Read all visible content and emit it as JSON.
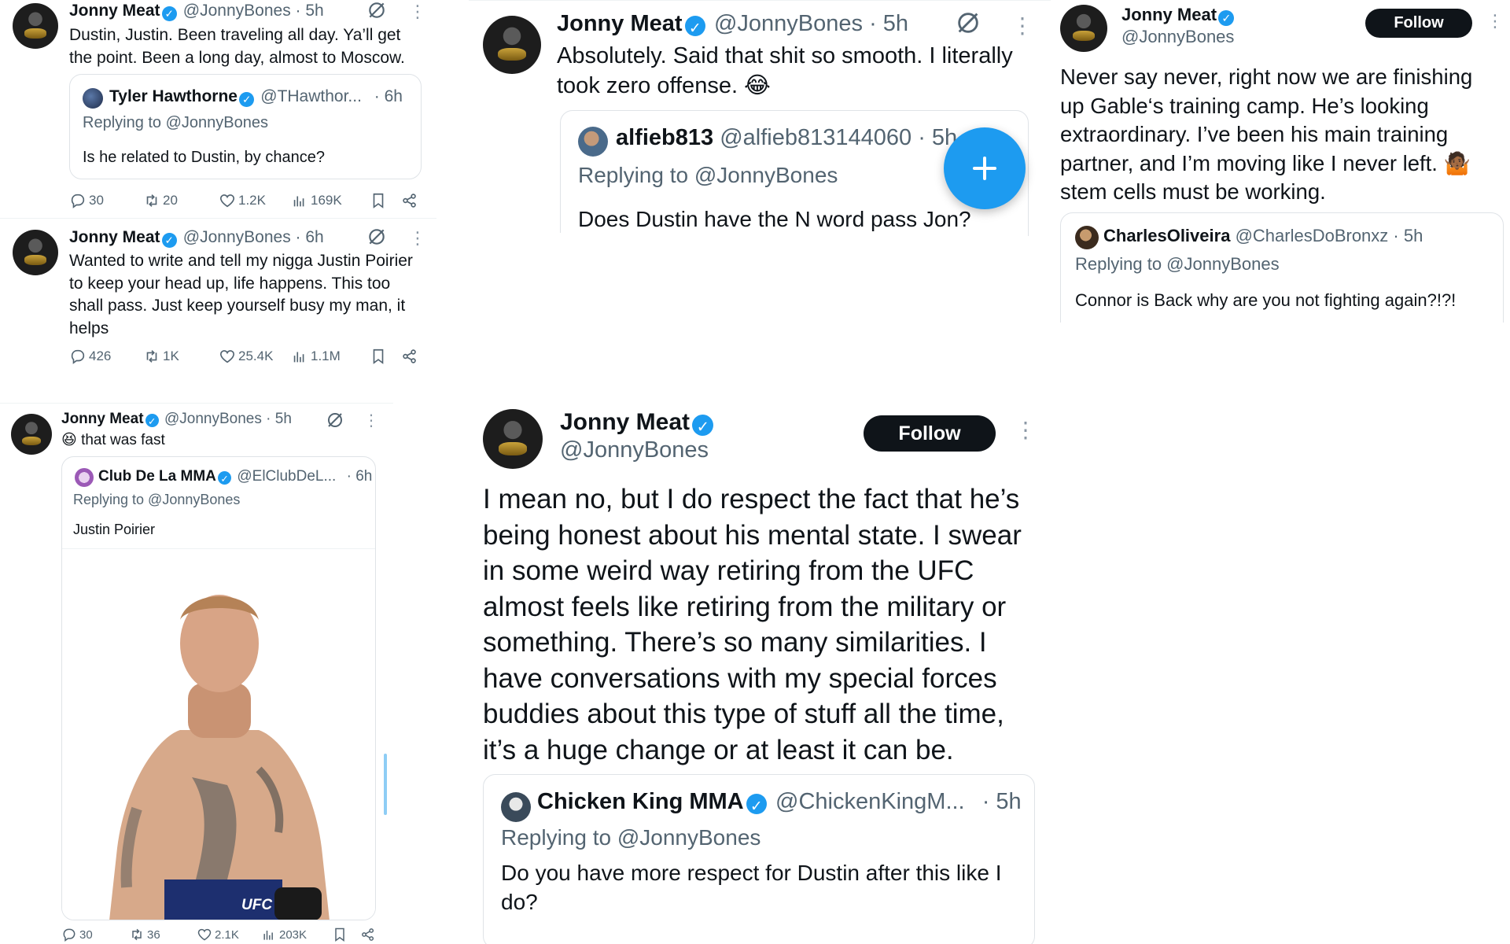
{
  "colors": {
    "accent": "#1d9bf0",
    "text": "#0f1419",
    "muted": "#536471"
  },
  "icons": [
    "grok-icon",
    "more-icon",
    "reply-icon",
    "retweet-icon",
    "like-icon",
    "views-icon",
    "bookmark-icon",
    "share-icon",
    "verified-icon",
    "compose-icon"
  ],
  "tweet1": {
    "name": "Jonny Meat",
    "handle": "@JonnyBones",
    "time": "· 5h",
    "text": "Dustin, Justin. Been traveling all day. Ya’ll get the point. Been a long day, almost to Moscow.",
    "quote": {
      "name": "Tyler Hawthorne",
      "handle": "@THawthor...",
      "time": "· 6h",
      "replying": "Replying to @JonnyBones",
      "text": "Is he related to Dustin, by chance?"
    },
    "stats": {
      "replies": "30",
      "retweets": "20",
      "likes": "1.2K",
      "views": "169K"
    }
  },
  "tweet2": {
    "name": "Jonny Meat",
    "handle": "@JonnyBones",
    "time": "· 6h",
    "text": "Wanted to write and tell my nigga Justin Poirier to keep your head up, life happens. This too shall pass. Just keep yourself busy my man, it helps",
    "stats": {
      "replies": "426",
      "retweets": "1K",
      "likes": "25.4K",
      "views": "1.1M"
    }
  },
  "tweet3": {
    "name": "Jonny Meat",
    "handle": "@JonnyBones",
    "time": "· 5h",
    "text": "😆 that was fast",
    "quote": {
      "name": "Club De La MMA",
      "handle": "@ElClubDeL...",
      "time": "· 6h",
      "replying": "Replying to @JonnyBones",
      "text": "Justin Poirier",
      "image_badge": "UFC"
    },
    "stats": {
      "replies": "30",
      "retweets": "36",
      "likes": "2.1K",
      "views": "203K"
    }
  },
  "tweet4": {
    "name": "Jonny Meat",
    "handle": "@JonnyBones",
    "time": "· 5h",
    "text": "Absolutely. Said that shit so smooth. I literally took zero offense. 😂",
    "quote": {
      "name": "alfieb813",
      "handle": "@alfieb813144060",
      "time": "· 5h",
      "replying": "Replying to @JonnyBones",
      "text": "Does Dustin have the N word pass Jon?"
    }
  },
  "tweet5": {
    "name": "Jonny Meat",
    "handle": "@JonnyBones",
    "follow": "Follow",
    "text": "I mean no, but I do respect the fact that he’s being honest about his mental state. I swear in some weird way retiring from the UFC almost feels like retiring from the military or something. There’s so many similarities. I have conversations with my special forces buddies about this type of stuff all the time, it’s a huge change or at least it can be.",
    "quote": {
      "name": "Chicken King MMA",
      "handle": "@ChickenKingM...",
      "time": "· 5h",
      "replying": "Replying to @JonnyBones",
      "text": "Do you have more respect for Dustin after this like I do?"
    }
  },
  "tweet6": {
    "name": "Jonny Meat",
    "handle": "@JonnyBones",
    "follow": "Follow",
    "text": "Never say never, right now we are finishing up Gable‘s training camp. He’s looking extraordinary. I’ve been his main training partner, and I’m moving like I never left. 🤷🏾 stem cells must be working.",
    "quote": {
      "name": "CharlesOliveira",
      "handle": "@CharlesDoBronxz",
      "time": "· 5h",
      "replying": "Replying to @JonnyBones",
      "text": "Connor is Back why are you not fighting again?!?!"
    }
  }
}
